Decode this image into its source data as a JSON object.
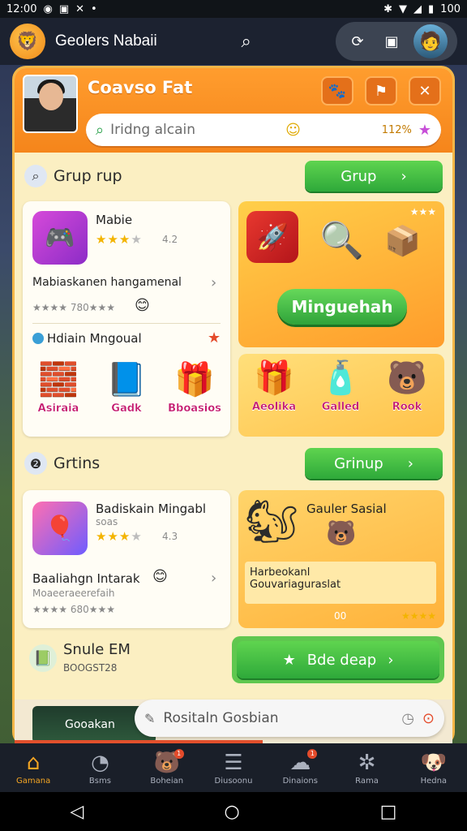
{
  "status_bar": {
    "time": "12:00",
    "icons_left": [
      "whatsapp-icon",
      "image-icon",
      "x-icon",
      "dot"
    ],
    "battery": "100"
  },
  "app_bar": {
    "title": "Geolers Nabaii"
  },
  "panel": {
    "title": "Coavso Fat",
    "search": {
      "placeholder": "Iridng alcain",
      "value": "112%"
    }
  },
  "section1": {
    "title": "Grup rup",
    "button_label": "Grup"
  },
  "card1": {
    "app_name": "Mabie",
    "rating": "4.2",
    "headline": "Mabiaskanen hangamenal",
    "stats": "★★★★ 780★★★",
    "subheading": "Hdiain Mngoual",
    "products": [
      {
        "label": "Asiraia",
        "icon": "🧱"
      },
      {
        "label": "Gadk",
        "icon": "📘"
      },
      {
        "label": "Bboasios",
        "icon": "🎁"
      }
    ]
  },
  "promo1": {
    "button_label": "Minguehah",
    "corner_stars": "★★★"
  },
  "promo2": {
    "items": [
      {
        "label": "Aeolika",
        "icon": "🎁"
      },
      {
        "label": "Galled",
        "icon": "🧴"
      },
      {
        "label": "Rook",
        "icon": "🐻"
      }
    ]
  },
  "section2": {
    "title": "Grtins",
    "button_label": "Grinup"
  },
  "card2": {
    "app_name": "Badiskain Mingabl",
    "app_sub": "soas",
    "rating": "4.3",
    "headline": "Baaliahgn Intarak",
    "sub_headline": "Moaeeraeerefaih",
    "stats": "★★★★ 680★★★"
  },
  "promo3": {
    "title": "Gauler Sasial",
    "body_line1": "Harbeokanl",
    "body_line2": "Gouvariaguraslat",
    "footer": "00",
    "footer_stars": "★★★★"
  },
  "section3": {
    "title": "Snule EM",
    "subtitle": "BOOGST28",
    "button_label": "Bde deap"
  },
  "bottom": {
    "thumb_label": "Gooakan",
    "search_placeholder": "Rositaln Gosbian"
  },
  "nav": [
    {
      "label": "Gamana",
      "icon": "home-icon",
      "active": true
    },
    {
      "label": "Bsms",
      "icon": "clock-icon",
      "active": false
    },
    {
      "label": "Boheian",
      "icon": "bear-icon",
      "active": false,
      "badge": "1"
    },
    {
      "label": "Diusoonu",
      "icon": "doc-icon",
      "active": false
    },
    {
      "label": "Dinaions",
      "icon": "chat-icon",
      "active": false,
      "badge": "1"
    },
    {
      "label": "Rama",
      "icon": "tool-icon",
      "active": false
    },
    {
      "label": "Hedna",
      "icon": "pet-icon",
      "active": false
    }
  ]
}
